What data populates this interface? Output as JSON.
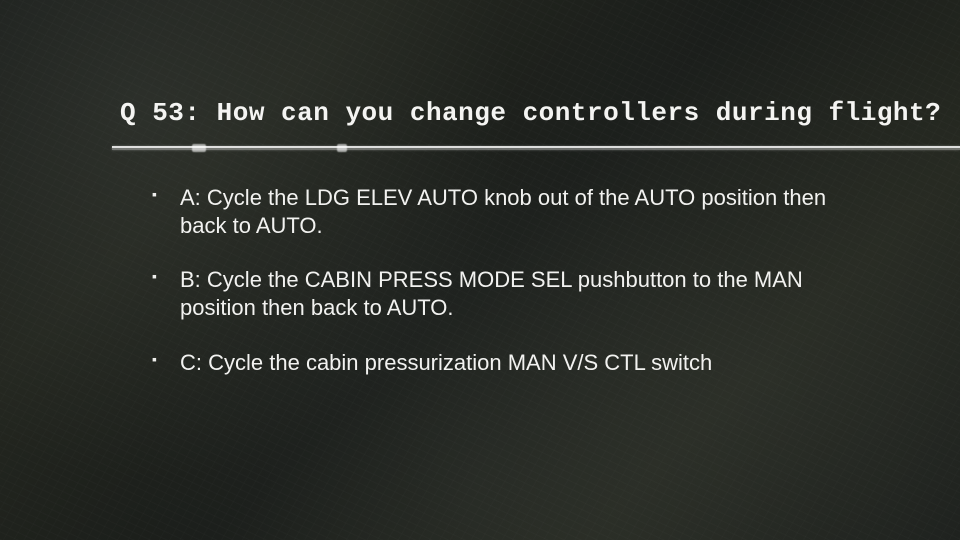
{
  "question": {
    "number_label": "Q 53:",
    "text": "How can you change controllers during flight?"
  },
  "answers": [
    {
      "letter": "A:",
      "text": "Cycle the LDG ELEV AUTO knob out of the AUTO position then back to AUTO."
    },
    {
      "letter": "B:",
      "text": "Cycle the CABIN PRESS MODE SEL pushbutton to the MAN position then back to AUTO."
    },
    {
      "letter": "C:",
      "text": "Cycle the cabin pressurization MAN V/S CTL switch"
    }
  ]
}
